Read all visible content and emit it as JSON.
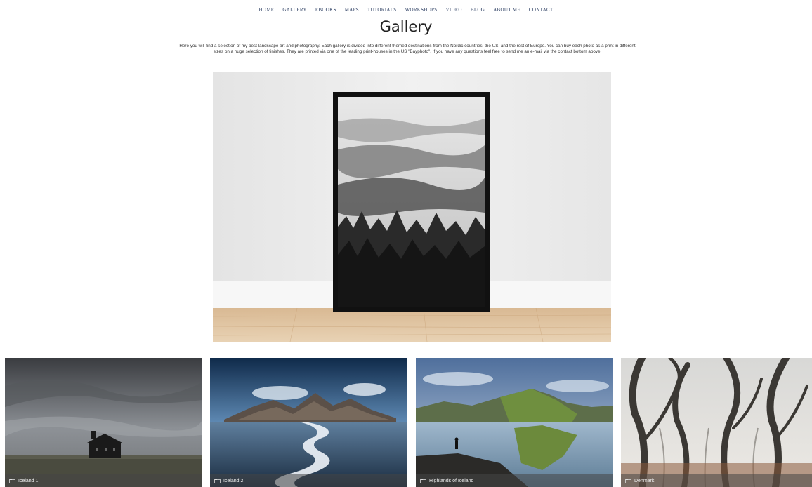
{
  "nav": {
    "items": [
      "HOME",
      "GALLERY",
      "EBOOKS",
      "MAPS",
      "TUTORIALS",
      "WORKSHOPS",
      "VIDEO",
      "BLOG",
      "ABOUT ME",
      "CONTACT"
    ]
  },
  "page": {
    "title": "Gallery",
    "intro_line1": "Here you will find a selection of my best landscape art and photography. Each gallery is divided into different themed destinations from the Nordic countries, the US, and the rest of Europe. You can buy each photo as a print in different",
    "intro_line2": "sizes on a huge selection of finishes. They are printed via one of the leading print-houses in the US \"Bayphoto\". If you have any questions feel free to send me an e-mail via the contact bottom above."
  },
  "galleries": [
    {
      "label": "Iceland 1"
    },
    {
      "label": "Iceland 2"
    },
    {
      "label": "Highlands of Iceland"
    },
    {
      "label": "Denmark"
    }
  ],
  "colors": {
    "nav_link": "#2d3f63",
    "caption_bg": "#464646"
  }
}
